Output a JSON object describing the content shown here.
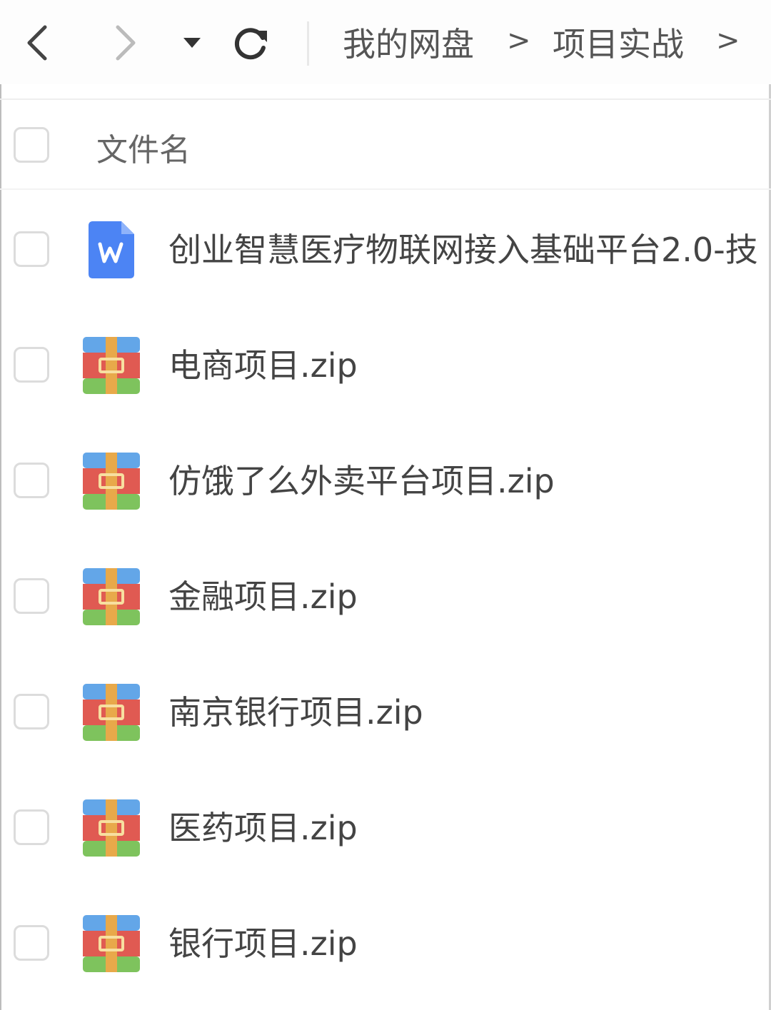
{
  "toolbar": {
    "back_icon": "chevron-left-icon",
    "forward_icon": "chevron-right-icon",
    "dropdown_icon": "caret-down-icon",
    "refresh_icon": "refresh-icon",
    "breadcrumbs": [
      "我的网盘",
      "项目实战"
    ],
    "separator": ">"
  },
  "list_header": {
    "column_name": "文件名"
  },
  "files": [
    {
      "name": "创业智慧医疗物联网接入基础平台2.0-技",
      "icon": "word-doc-icon"
    },
    {
      "name": "电商项目.zip",
      "icon": "zip-archive-icon"
    },
    {
      "name": "仿饿了么外卖平台项目.zip",
      "icon": "zip-archive-icon"
    },
    {
      "name": "金融项目.zip",
      "icon": "zip-archive-icon"
    },
    {
      "name": "南京银行项目.zip",
      "icon": "zip-archive-icon"
    },
    {
      "name": "医药项目.zip",
      "icon": "zip-archive-icon"
    },
    {
      "name": "银行项目.zip",
      "icon": "zip-archive-icon"
    }
  ],
  "colors": {
    "word_blue": "#4c84f4",
    "zip_blue": "#63a6e8",
    "zip_red": "#e05a52",
    "zip_green": "#7ec35d",
    "zip_strap": "#e8a94a"
  }
}
